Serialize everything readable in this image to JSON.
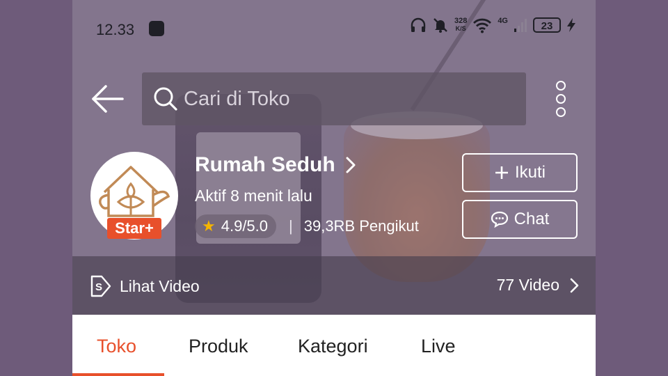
{
  "status_bar": {
    "time": "12.33",
    "net_speed_value": "328",
    "net_speed_unit": "K/S",
    "network": "4G",
    "battery": "23"
  },
  "search": {
    "placeholder": "Cari di Toko"
  },
  "shop": {
    "name": "Rumah Seduh",
    "badge": "Star+",
    "active_status": "Aktif 8 menit lalu",
    "rating": "4.9/5.0",
    "followers": "39,3RB Pengikut"
  },
  "actions": {
    "follow_label": "Ikuti",
    "chat_label": "Chat"
  },
  "video_bar": {
    "label": "Lihat Video",
    "count": "77 Video"
  },
  "tabs": [
    {
      "label": "Toko",
      "active": true
    },
    {
      "label": "Produk",
      "active": false
    },
    {
      "label": "Kategori",
      "active": false
    },
    {
      "label": "Live",
      "active": false
    }
  ],
  "colors": {
    "accent": "#e8502b",
    "star": "#f5b400"
  },
  "icons": {
    "back": "arrow-left-icon",
    "search": "search-icon",
    "more": "more-vertical-icon",
    "chevron": "chevron-right-icon",
    "plus": "plus-icon",
    "chat": "chat-bubble-icon",
    "video": "video-icon",
    "star": "star-icon"
  }
}
